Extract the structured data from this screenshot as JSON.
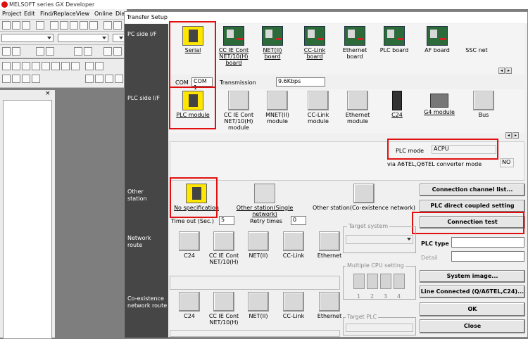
{
  "app": {
    "title": "MELSOFT series GX Developer",
    "menu": [
      "Project",
      "Edit",
      "Find/Replace",
      "View",
      "Online",
      "Dia"
    ],
    "pane_close": "×"
  },
  "dialog": {
    "title": "Transfer Setup",
    "sections": {
      "pc_side": "PC side I/F",
      "plc_side": "PLC side I/F",
      "other_station": "Other station",
      "network_route": "Network route",
      "coexistence_route": "Co-existence network route"
    },
    "pc_side_items": [
      {
        "label": "Serial",
        "icon": "serial-port-icon"
      },
      {
        "label": "CC IE Cont NET/10(H) board",
        "icon": "board-icon"
      },
      {
        "label": "NET(II) board",
        "icon": "board-icon"
      },
      {
        "label": "CC-Link board",
        "icon": "board-icon"
      },
      {
        "label": "Ethernet board",
        "icon": "board-icon"
      },
      {
        "label": "PLC board",
        "icon": "board-icon"
      },
      {
        "label": "AF board",
        "icon": "board-icon"
      },
      {
        "label": "SSC net",
        "icon": "none"
      }
    ],
    "com": {
      "label": "COM",
      "value": "COM 1",
      "transmission_label": "Transmission",
      "transmission_value": "9.6Kbps"
    },
    "plc_side_items": [
      {
        "label": "PLC module",
        "icon": "plc-module-icon"
      },
      {
        "label": "CC IE Cont NET/10(H) module",
        "icon": "gray-button-icon"
      },
      {
        "label": "MNET(II) module",
        "icon": "gray-button-icon"
      },
      {
        "label": "CC-Link module",
        "icon": "gray-button-icon"
      },
      {
        "label": "Ethernet module",
        "icon": "gray-button-icon"
      },
      {
        "label": "C24",
        "icon": "c24-module-icon"
      },
      {
        "label": "G4 module",
        "icon": "g4-module-icon"
      },
      {
        "label": "Bus",
        "icon": "gray-button-icon"
      }
    ],
    "plc_mode": {
      "label": "PLC mode",
      "value": "ACPU"
    },
    "converter": {
      "label": "via A6TEL,Q6TEL converter mode",
      "value": "NO"
    },
    "other_station_items": [
      {
        "label": "No specification",
        "icon": "computer-icon"
      },
      {
        "label": "Other station(Single network)",
        "icon": "network-icon"
      },
      {
        "label": "Other station(Co-existence network)",
        "icon": "gray-button-icon"
      }
    ],
    "timeout": {
      "label": "Time out (Sec.)",
      "value": "5"
    },
    "retry": {
      "label": "Retry times",
      "value": "0"
    },
    "target_system": {
      "label": "Target system",
      "value": ""
    },
    "multiple_cpu": {
      "label": "Multiple CPU setting",
      "numbers": [
        "1",
        "2",
        "3",
        "4"
      ]
    },
    "target_plc": {
      "label": "Target PLC"
    },
    "network_items": [
      "C24",
      "CC IE Cont NET/10(H)",
      "NET(II)",
      "CC-Link",
      "Ethernet"
    ],
    "coexistence_items": [
      "C24",
      "CC IE Cont NET/10(H)",
      "NET(II)",
      "CC-Link",
      "Ethernet"
    ],
    "plc_type": {
      "label": "PLC type",
      "value": ""
    },
    "detail": {
      "label": "Detail"
    },
    "buttons": {
      "connection_list": "Connection channel list...",
      "plc_direct": "PLC direct coupled setting",
      "connection_test": "Connection test",
      "system_image": "System image...",
      "line_connected": "Line Connected (Q/A6TEL,C24)...",
      "ok": "OK",
      "close": "Close"
    },
    "scroll": {
      "left": "◂",
      "right": "▸"
    }
  },
  "colors": {
    "highlight": "#e01010",
    "sidebar": "#464646",
    "selected_icon": "#ffe600"
  }
}
